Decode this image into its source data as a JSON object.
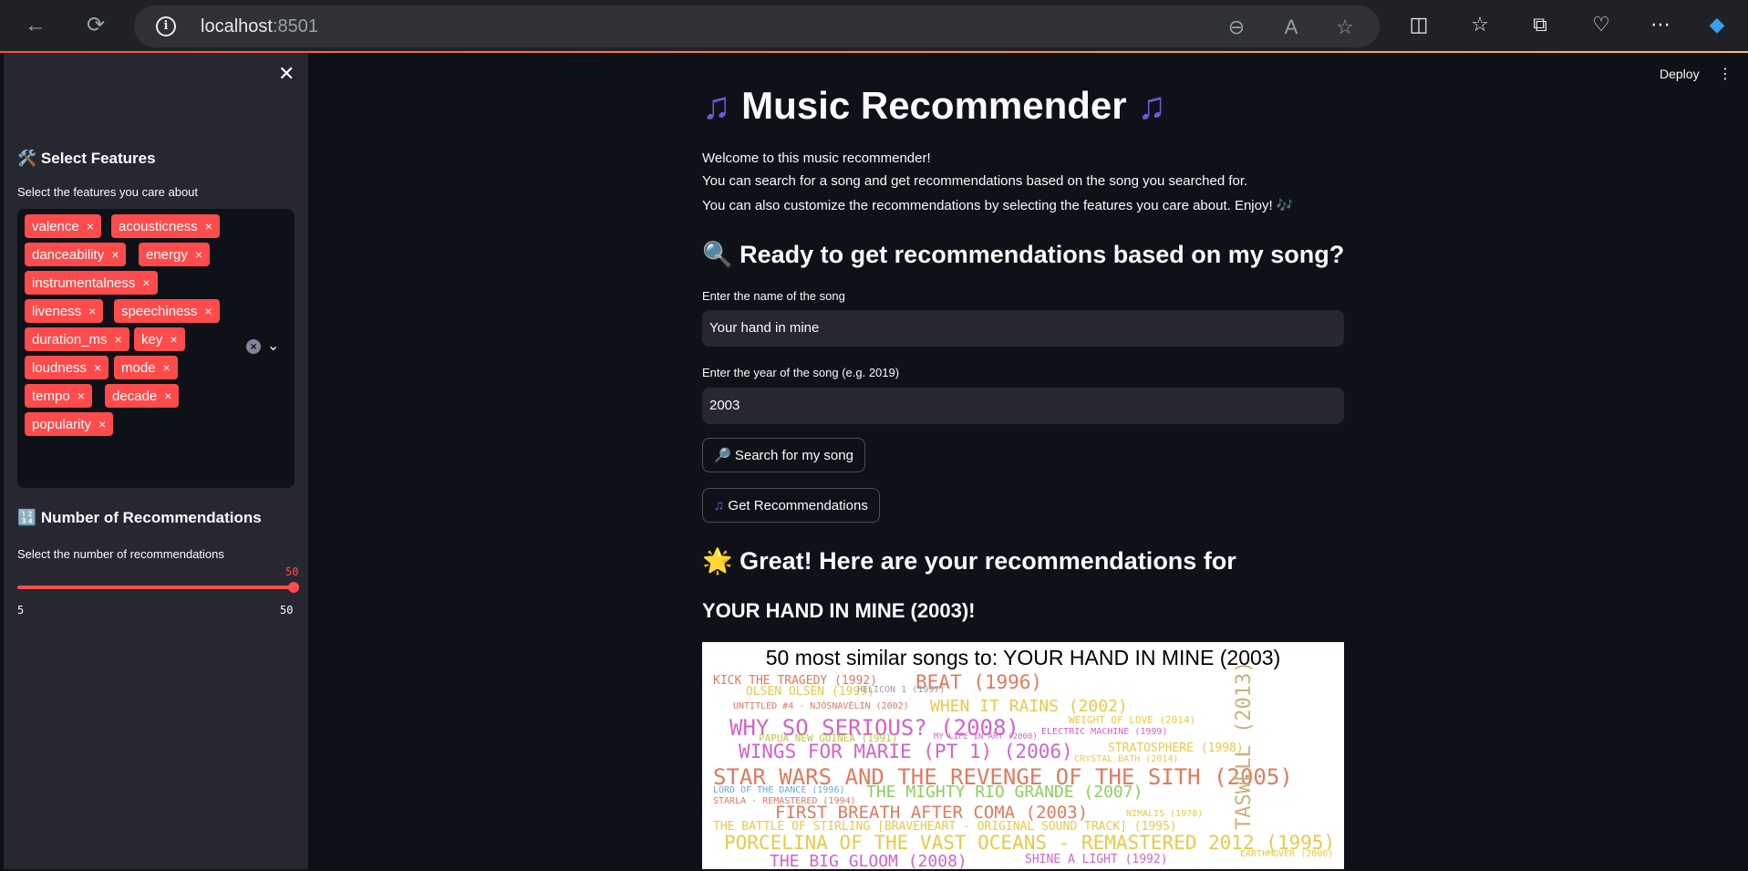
{
  "browser": {
    "url_host": "localhost",
    "url_port": ":8501"
  },
  "sidebar": {
    "features_heading": "Select Features",
    "features_icon": "🛠️",
    "features_label": "Select the features you care about",
    "features": [
      "valence",
      "acousticness",
      "danceability",
      "energy",
      "instrumentalness",
      "liveness",
      "speechiness",
      "duration_ms",
      "key",
      "loudness",
      "mode",
      "tempo",
      "decade",
      "popularity"
    ],
    "num_heading": "Number of Recommendations",
    "num_icon": "🔢",
    "num_label": "Select the number of recommendations",
    "slider": {
      "value": "50",
      "min": "5",
      "max": "50",
      "fraction": 1.0
    }
  },
  "header": {
    "deploy_label": "Deploy"
  },
  "main": {
    "title": "Music Recommender",
    "intro": [
      "Welcome to this music recommender!",
      "You can search for a song and get recommendations based on the song you searched for.",
      "You can also customize the recommendations by selecting the features you care about. Enjoy! 🎶"
    ],
    "ready_heading": "Ready to get recommendations based on my song?",
    "song_label": "Enter the name of the song",
    "song_value": "Your hand in mine",
    "year_label": "Enter the year of the song (e.g. 2019)",
    "year_value": "2003",
    "search_button": "Search for my song",
    "recommend_button": "Get Recommendations",
    "great_heading": "Great! Here are your recommendations for",
    "song_heading": "YOUR HAND IN MINE (2003)!",
    "cloud_title": "50 most similar songs to: YOUR HAND IN MINE (2003)",
    "cloud_words": [
      "KICK THE TRAGEDY (1992)",
      "OLSEN OLSEN (1999)",
      "BEAT (1996)",
      "HELICON 1 (1997)",
      "UNTITLED #4 - NJÓSNAVÉLIN (2002)",
      "WHEN IT RAINS (2002)",
      "WHY SO SERIOUS? (2008)",
      "WEIGHT OF LOVE (2014)",
      "ELECTRIC MACHINE (1999)",
      "PAPUA NEW GUINEA (1991)",
      "MY LIFE IN ART (2000)",
      "WINGS FOR MARIE (PT 1) (2006)",
      "STRATOSPHERE (1998)",
      "CRYSTAL BATH (2014)",
      "STAR WARS AND THE REVENGE OF THE SITH (2005)",
      "LORD OF THE DANCE (1996)",
      "THE MIGHTY RIO GRANDE (2007)",
      "STARLA - REMASTERED (1994)",
      "FIRST BREATH AFTER COMA (2003)",
      "NIMALIS (1978)",
      "THE BATTLE OF STIRLING [BRAVEHEART - ORIGINAL SOUND TRACK] (1995)",
      "PORCELINA OF THE VAST OCEANS - REMASTERED 2012 (1995)",
      "THE BIG GLOOM (2008)",
      "SHINE A LIGHT (1992)",
      "EARTHMOVER (2006)",
      "TASWELL (2013)"
    ]
  }
}
